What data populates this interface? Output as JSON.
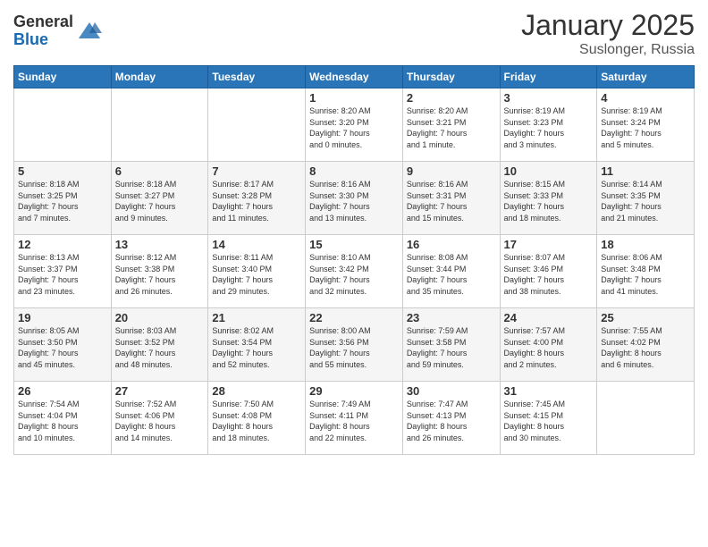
{
  "logo": {
    "general": "General",
    "blue": "Blue"
  },
  "header": {
    "month": "January 2025",
    "location": "Suslonger, Russia"
  },
  "days_header": [
    "Sunday",
    "Monday",
    "Tuesday",
    "Wednesday",
    "Thursday",
    "Friday",
    "Saturday"
  ],
  "weeks": [
    [
      {
        "day": "",
        "info": ""
      },
      {
        "day": "",
        "info": ""
      },
      {
        "day": "",
        "info": ""
      },
      {
        "day": "1",
        "info": "Sunrise: 8:20 AM\nSunset: 3:20 PM\nDaylight: 7 hours\nand 0 minutes."
      },
      {
        "day": "2",
        "info": "Sunrise: 8:20 AM\nSunset: 3:21 PM\nDaylight: 7 hours\nand 1 minute."
      },
      {
        "day": "3",
        "info": "Sunrise: 8:19 AM\nSunset: 3:23 PM\nDaylight: 7 hours\nand 3 minutes."
      },
      {
        "day": "4",
        "info": "Sunrise: 8:19 AM\nSunset: 3:24 PM\nDaylight: 7 hours\nand 5 minutes."
      }
    ],
    [
      {
        "day": "5",
        "info": "Sunrise: 8:18 AM\nSunset: 3:25 PM\nDaylight: 7 hours\nand 7 minutes."
      },
      {
        "day": "6",
        "info": "Sunrise: 8:18 AM\nSunset: 3:27 PM\nDaylight: 7 hours\nand 9 minutes."
      },
      {
        "day": "7",
        "info": "Sunrise: 8:17 AM\nSunset: 3:28 PM\nDaylight: 7 hours\nand 11 minutes."
      },
      {
        "day": "8",
        "info": "Sunrise: 8:16 AM\nSunset: 3:30 PM\nDaylight: 7 hours\nand 13 minutes."
      },
      {
        "day": "9",
        "info": "Sunrise: 8:16 AM\nSunset: 3:31 PM\nDaylight: 7 hours\nand 15 minutes."
      },
      {
        "day": "10",
        "info": "Sunrise: 8:15 AM\nSunset: 3:33 PM\nDaylight: 7 hours\nand 18 minutes."
      },
      {
        "day": "11",
        "info": "Sunrise: 8:14 AM\nSunset: 3:35 PM\nDaylight: 7 hours\nand 21 minutes."
      }
    ],
    [
      {
        "day": "12",
        "info": "Sunrise: 8:13 AM\nSunset: 3:37 PM\nDaylight: 7 hours\nand 23 minutes."
      },
      {
        "day": "13",
        "info": "Sunrise: 8:12 AM\nSunset: 3:38 PM\nDaylight: 7 hours\nand 26 minutes."
      },
      {
        "day": "14",
        "info": "Sunrise: 8:11 AM\nSunset: 3:40 PM\nDaylight: 7 hours\nand 29 minutes."
      },
      {
        "day": "15",
        "info": "Sunrise: 8:10 AM\nSunset: 3:42 PM\nDaylight: 7 hours\nand 32 minutes."
      },
      {
        "day": "16",
        "info": "Sunrise: 8:08 AM\nSunset: 3:44 PM\nDaylight: 7 hours\nand 35 minutes."
      },
      {
        "day": "17",
        "info": "Sunrise: 8:07 AM\nSunset: 3:46 PM\nDaylight: 7 hours\nand 38 minutes."
      },
      {
        "day": "18",
        "info": "Sunrise: 8:06 AM\nSunset: 3:48 PM\nDaylight: 7 hours\nand 41 minutes."
      }
    ],
    [
      {
        "day": "19",
        "info": "Sunrise: 8:05 AM\nSunset: 3:50 PM\nDaylight: 7 hours\nand 45 minutes."
      },
      {
        "day": "20",
        "info": "Sunrise: 8:03 AM\nSunset: 3:52 PM\nDaylight: 7 hours\nand 48 minutes."
      },
      {
        "day": "21",
        "info": "Sunrise: 8:02 AM\nSunset: 3:54 PM\nDaylight: 7 hours\nand 52 minutes."
      },
      {
        "day": "22",
        "info": "Sunrise: 8:00 AM\nSunset: 3:56 PM\nDaylight: 7 hours\nand 55 minutes."
      },
      {
        "day": "23",
        "info": "Sunrise: 7:59 AM\nSunset: 3:58 PM\nDaylight: 7 hours\nand 59 minutes."
      },
      {
        "day": "24",
        "info": "Sunrise: 7:57 AM\nSunset: 4:00 PM\nDaylight: 8 hours\nand 2 minutes."
      },
      {
        "day": "25",
        "info": "Sunrise: 7:55 AM\nSunset: 4:02 PM\nDaylight: 8 hours\nand 6 minutes."
      }
    ],
    [
      {
        "day": "26",
        "info": "Sunrise: 7:54 AM\nSunset: 4:04 PM\nDaylight: 8 hours\nand 10 minutes."
      },
      {
        "day": "27",
        "info": "Sunrise: 7:52 AM\nSunset: 4:06 PM\nDaylight: 8 hours\nand 14 minutes."
      },
      {
        "day": "28",
        "info": "Sunrise: 7:50 AM\nSunset: 4:08 PM\nDaylight: 8 hours\nand 18 minutes."
      },
      {
        "day": "29",
        "info": "Sunrise: 7:49 AM\nSunset: 4:11 PM\nDaylight: 8 hours\nand 22 minutes."
      },
      {
        "day": "30",
        "info": "Sunrise: 7:47 AM\nSunset: 4:13 PM\nDaylight: 8 hours\nand 26 minutes."
      },
      {
        "day": "31",
        "info": "Sunrise: 7:45 AM\nSunset: 4:15 PM\nDaylight: 8 hours\nand 30 minutes."
      },
      {
        "day": "",
        "info": ""
      }
    ]
  ]
}
